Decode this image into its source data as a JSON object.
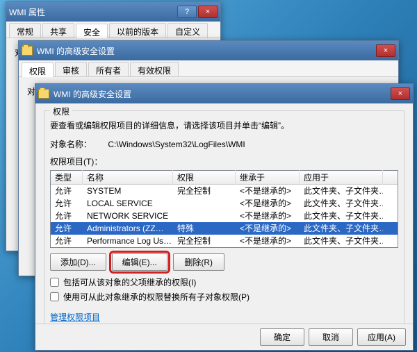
{
  "win1": {
    "title": "WMI 属性",
    "tabs": [
      "常规",
      "共享",
      "安全",
      "以前的版本",
      "自定义"
    ],
    "active_tab": 2,
    "object_label": "对象名称："
  },
  "win2": {
    "title": "WMI 的高级安全设置",
    "tabs": [
      "权限",
      "审核",
      "所有者",
      "有效权限"
    ],
    "active_tab": 0,
    "object_label": "对象名称："
  },
  "win3": {
    "title": "WMI 的高级安全设置",
    "groupbox": "权限",
    "instruction": "要查看或编辑权限项目的详细信息，请选择该项目并单击“编辑”。",
    "object_name_label": "对象名称：",
    "object_name_value": "C:\\Windows\\System32\\LogFiles\\WMI",
    "perm_items_label": "权限项目(T)：",
    "columns": {
      "type": "类型",
      "name": "名称",
      "perm": "权限",
      "inh": "继承于",
      "app": "应用于"
    },
    "rows": [
      {
        "type": "允许",
        "name": "SYSTEM",
        "perm": "完全控制",
        "inh": "<不是继承的>",
        "app": "此文件夹、子文件夹…",
        "selected": false
      },
      {
        "type": "允许",
        "name": "LOCAL SERVICE",
        "perm": "",
        "inh": "<不是继承的>",
        "app": "此文件夹、子文件夹…",
        "selected": false
      },
      {
        "type": "允许",
        "name": "NETWORK SERVICE",
        "perm": "",
        "inh": "<不是继承的>",
        "app": "此文件夹、子文件夹…",
        "selected": false
      },
      {
        "type": "允许",
        "name": "Administrators (ZZ…",
        "perm": "特殊",
        "inh": "<不是继承的>",
        "app": "此文件夹、子文件夹…",
        "selected": true
      },
      {
        "type": "允许",
        "name": "Performance Log Us…",
        "perm": "完全控制",
        "inh": "<不是继承的>",
        "app": "此文件夹、子文件夹…",
        "selected": false
      }
    ],
    "buttons": {
      "add": "添加(D)...",
      "edit": "编辑(E)...",
      "remove": "删除(R)"
    },
    "chk1": "包括可从该对象的父项继承的权限(I)",
    "chk2": "使用可从此对象继承的权限替换所有子对象权限(P)",
    "link": "管理权限项目",
    "footer": {
      "ok": "确定",
      "cancel": "取消",
      "apply": "应用(A)"
    }
  }
}
